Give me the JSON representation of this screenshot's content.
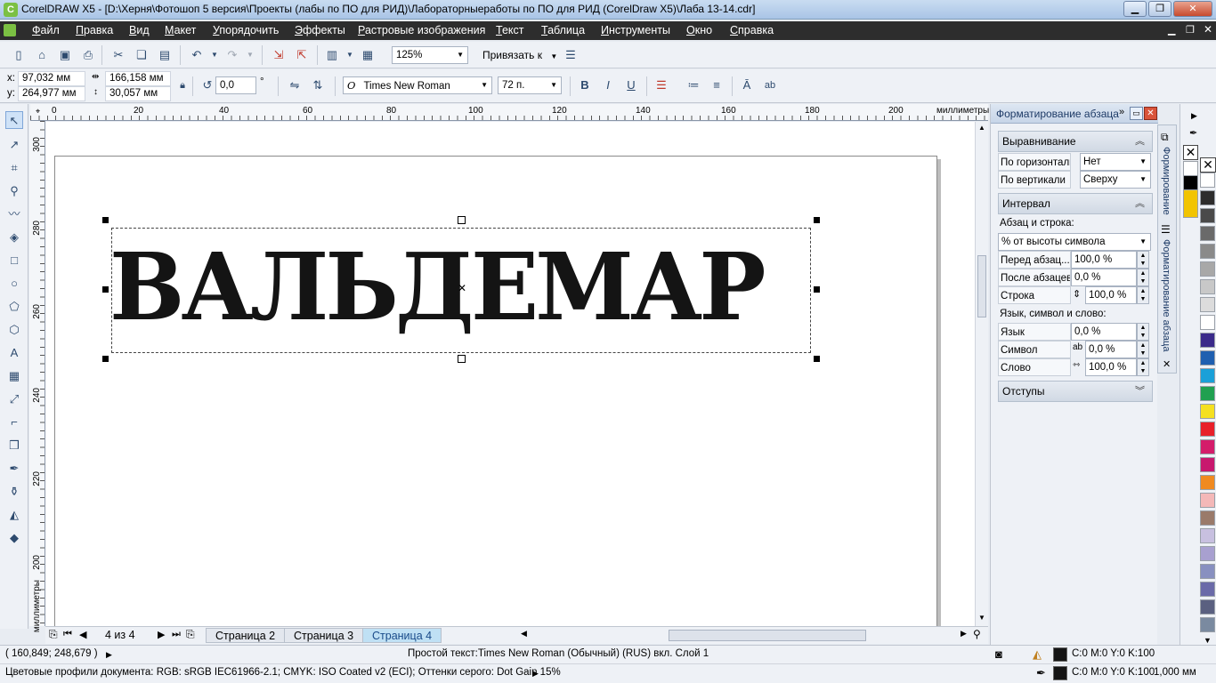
{
  "window": {
    "title": "CorelDRAW X5 - [D:\\Херня\\Фотошоп 5 версия\\Проекты (лабы по ПО для РИД)\\Лабораторныеработы по ПО для РИД (CorelDraw X5)\\Лаба 13-14.cdr]",
    "min": "▁",
    "max": "❐",
    "close": "✕"
  },
  "menu": {
    "items": [
      "Файл",
      "Правка",
      "Вид",
      "Макет",
      "Упорядочить",
      "Эффекты",
      "Растровые изображения",
      "Текст",
      "Таблица",
      "Инструменты",
      "Окно",
      "Справка"
    ]
  },
  "toolbar": {
    "zoom": "125%",
    "snap": "Привязать к"
  },
  "props": {
    "x": "97,032 мм",
    "y": "264,977 мм",
    "x_label": "x:",
    "y_label": "y:",
    "width": "166,158 мм",
    "height": "30,057 мм",
    "angle": "0,0",
    "angle_unit": "°",
    "font": "Times New Roman",
    "font_size": "72 п.",
    "font_icon": "O"
  },
  "ruler": {
    "h_ticks": [
      "0",
      "20",
      "40",
      "60",
      "80",
      "100",
      "120",
      "140",
      "160",
      "180",
      "200"
    ],
    "h_unit": "миллиметры",
    "v_ticks": [
      "300",
      "280",
      "260",
      "240",
      "220",
      "200"
    ],
    "v_unit": "миллиметры"
  },
  "canvas": {
    "text": "ВАЛЬДЕМАР"
  },
  "pages": {
    "counter": "4 из 4",
    "tabs": [
      "Страница 2",
      "Страница 3",
      "Страница 4"
    ],
    "active": "Страница 4"
  },
  "status": {
    "coords": "( 160,849; 248,679 )",
    "object_info": "Простой текст:Times New Roman (Обычный) (RUS) вкл. Слой 1",
    "fill": "C:0 M:0 Y:0 K:100",
    "outline": "C:0 M:0 Y:0 K:100",
    "outline_width": "1,000 мм",
    "color_profiles": "Цветовые профили документа: RGB: sRGB IEC61966-2.1; CMYK: ISO Coated v2 (ECI); Оттенки серого: Dot Gain 15%"
  },
  "docker": {
    "title": "Форматирование абзаца",
    "alignment": {
      "header": "Выравнивание",
      "horizontal_label": "По горизонтали",
      "horizontal_value": "Нет",
      "vertical_label": "По вертикали",
      "vertical_value": "Сверху"
    },
    "spacing": {
      "header": "Интервал",
      "para_line_label": "Абзац и строка:",
      "mode": "% от высоты символа",
      "before_label": "Перед абзац...",
      "before_value": "100,0 %",
      "after_label": "После абзацев",
      "after_value": "0,0 %",
      "line_label": "Строка",
      "line_value": "100,0 %",
      "lang_char_word_label": "Язык, символ и слово:",
      "lang_label": "Язык",
      "lang_value": "0,0 %",
      "char_label": "Символ",
      "char_value": "0,0 %",
      "word_label": "Слово",
      "word_value": "100,0 %"
    },
    "indents": {
      "header": "Отступы"
    },
    "side_tab_1": "Формирование",
    "side_tab_2": "Форматирование абзаца"
  },
  "palette": {
    "colors": [
      "#ffffff",
      "#000000",
      "#f2c400",
      "#ffffff",
      "#2d2d2d",
      "#4a4a4a",
      "#6a6a6a",
      "#8a8a8a",
      "#a8a8a8",
      "#c8c8c8",
      "#dcdcdc",
      "#ffffff",
      "#3a2a8a",
      "#1f5fb0",
      "#1aa0d8",
      "#20a050",
      "#f5e020",
      "#e8202a",
      "#d41c6a",
      "#c8186e",
      "#f08a20",
      "#f4b8b8",
      "#9a7a6a",
      "#c8c0e0",
      "#a8a0d0",
      "#8890c0",
      "#6a6aa8",
      "#5a6080",
      "#7a8aa0"
    ]
  }
}
